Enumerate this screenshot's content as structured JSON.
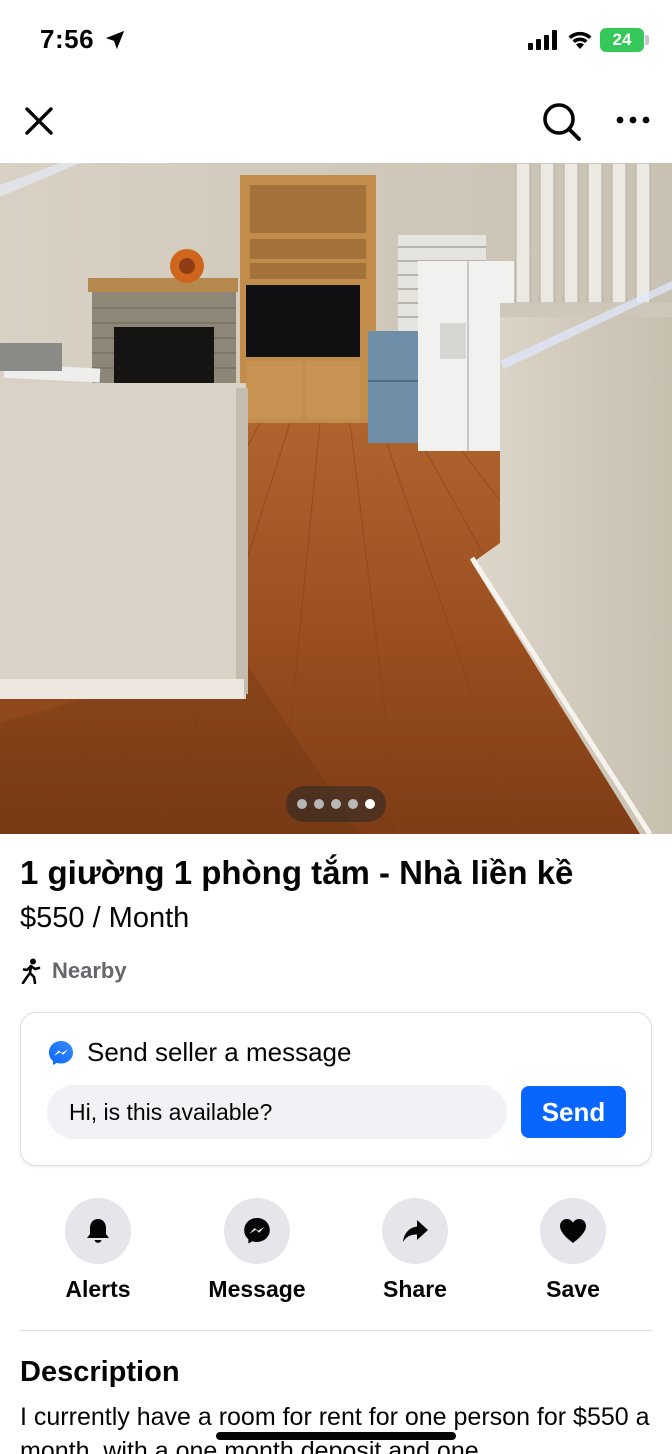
{
  "status_bar": {
    "time": "7:56",
    "battery": "24"
  },
  "nav": {
    "icons": [
      "close-icon",
      "search-icon",
      "more-icon"
    ]
  },
  "photo": {
    "description_icon": "listing-photo",
    "page_count": 5,
    "active_page": 5
  },
  "listing": {
    "title": "1 giường 1 phòng tắm - Nhà liền kề",
    "price": "$550 / Month",
    "distance": "Nearby"
  },
  "message_card": {
    "heading": "Send seller a message",
    "input_value": "Hi, is this available?",
    "send_label": "Send"
  },
  "actions": [
    {
      "label": "Alerts",
      "icon": "bell-icon"
    },
    {
      "label": "Message",
      "icon": "messenger-icon"
    },
    {
      "label": "Share",
      "icon": "share-arrow-icon"
    },
    {
      "label": "Save",
      "icon": "heart-icon"
    }
  ],
  "description": {
    "heading": "Description",
    "text": "I currently have a room for rent for one person for $550 a month, with a one month deposit and one"
  },
  "colors": {
    "accent": "#0866ff",
    "battery": "#34c759",
    "action_bg": "#e4e6eb",
    "input_bg": "#f0f2f5",
    "secondary_text": "#65676b"
  }
}
